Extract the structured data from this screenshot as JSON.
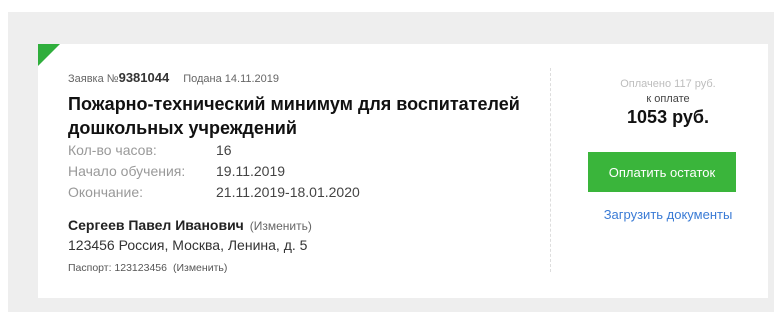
{
  "order": {
    "label": "Заявка №",
    "number": "9381044",
    "submitted": "Подана 14.11.2019"
  },
  "course": {
    "title": "Пожарно-технический минимум для воспитателей дошкольных учреждений"
  },
  "details": [
    {
      "label": "Кол-во часов:",
      "value": "16"
    },
    {
      "label": "Начало обучения:",
      "value": "19.11.2019"
    },
    {
      "label": "Окончание:",
      "value": "21.11.2019-18.01.2020"
    }
  ],
  "person": {
    "name": "Сергеев Павел Иванович",
    "change_label": "(Изменить)",
    "address": "123456 Россия, Москва, Ленина, д. 5"
  },
  "passport": {
    "text": "Паспорт: 123123456",
    "change_label": "(Изменить)"
  },
  "payment": {
    "paid": "Оплачено 117 руб.",
    "due_label": "к оплате",
    "due_amount": "1053 руб.",
    "pay_button": "Оплатить остаток",
    "upload_link": "Загрузить документы"
  },
  "colors": {
    "accent": "#3ab53b",
    "link": "#3a7bd5"
  }
}
